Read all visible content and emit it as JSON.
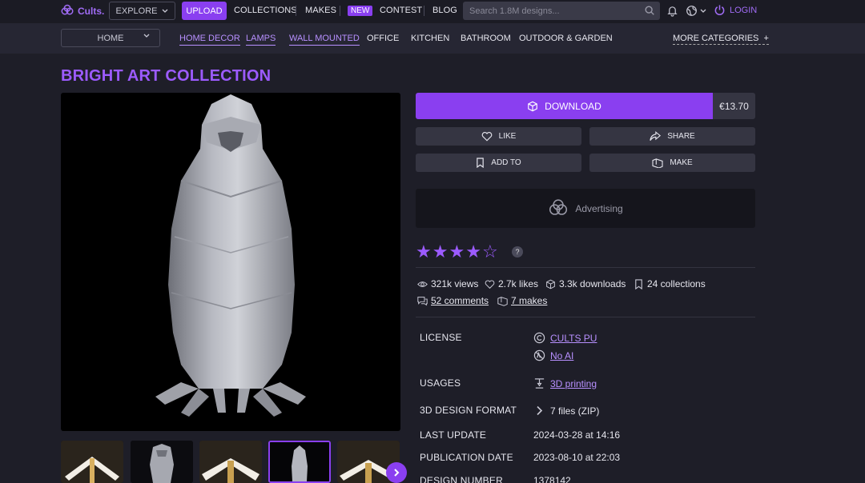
{
  "header": {
    "logo_text": "Cults.",
    "explore_label": "EXPLORE",
    "upload_label": "UPLOAD",
    "nav": {
      "collections": "COLLECTIONS",
      "makes": "MAKES",
      "new_badge": "NEW",
      "contest": "CONTEST",
      "blog": "BLOG"
    },
    "search_placeholder": "Search 1.8M designs...",
    "login_label": "LOGIN"
  },
  "categories": {
    "home_select": "HOME",
    "items": [
      "HOME DECOR",
      "LAMPS",
      "WALL MOUNTED",
      "OFFICE",
      "KITCHEN",
      "BATHROOM",
      "OUTDOOR & GARDEN"
    ],
    "more_label": "MORE CATEGORIES"
  },
  "product": {
    "title": "BRIGHT ART COLLECTION",
    "download_label": "DOWNLOAD",
    "price": "€13.70",
    "actions": {
      "like": "LIKE",
      "share": "SHARE",
      "add_to": "ADD TO",
      "make": "MAKE"
    },
    "advertising": "Advertising",
    "rating": {
      "filled": 4,
      "total": 5,
      "help": "?"
    },
    "stats": {
      "views": "321k views",
      "likes": "2.7k likes",
      "downloads": "3.3k downloads",
      "collections": "24 collections",
      "comments": "52 comments",
      "makes": "7 makes"
    },
    "details": {
      "license_label": "LICENSE",
      "license_value": "CULTS PU",
      "ai_value": "No AI",
      "usages_label": "USAGES",
      "usages_value": "3D printing",
      "format_label": "3D DESIGN FORMAT",
      "format_value": "7 files (ZIP)",
      "last_update_label": "LAST UPDATE",
      "last_update_value": "2024-03-28 at 14:16",
      "publication_label": "PUBLICATION DATE",
      "publication_value": "2023-08-10 at 22:03",
      "design_number_label": "DESIGN NUMBER",
      "design_number_value": "1378142"
    }
  },
  "colors": {
    "accent": "#8a3ff0",
    "accent_text": "#9c5bff",
    "bg": "#1e1e28",
    "panel": "#353542"
  },
  "icons": [
    "cults-logo-icon",
    "chevron-down-icon",
    "search-icon",
    "bell-icon",
    "globe-icon",
    "power-icon",
    "cube-icon",
    "heart-icon",
    "share-icon",
    "bookmark-icon",
    "make-icon",
    "eye-icon",
    "comment-icon",
    "copyright-icon",
    "no-ai-icon",
    "printer-icon",
    "chevron-right-icon",
    "arrow-right-icon"
  ]
}
